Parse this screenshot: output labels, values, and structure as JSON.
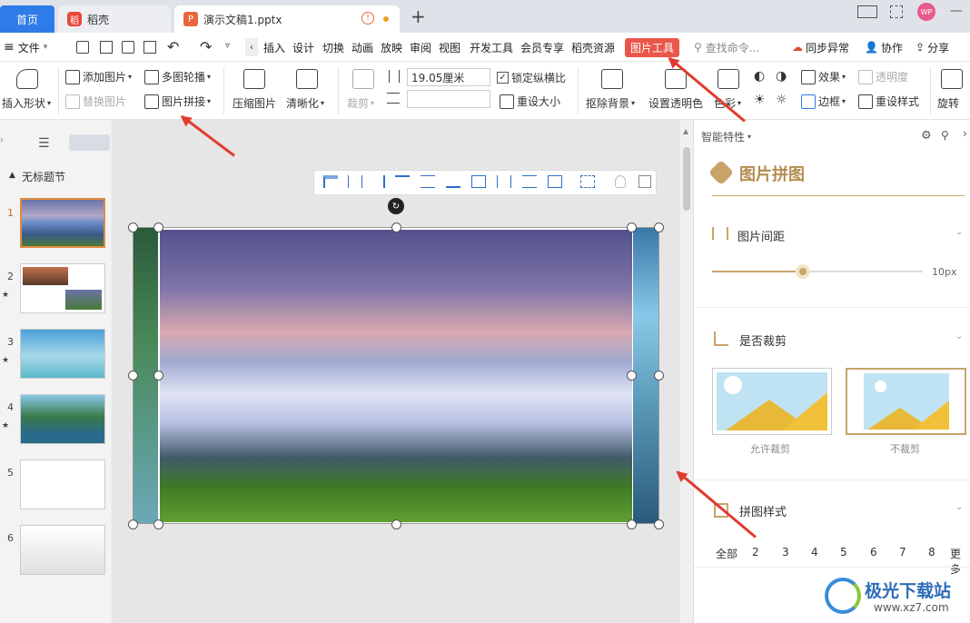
{
  "tabs": {
    "home": "首页",
    "daoke": "稻壳",
    "doc": "演示文稿1.pptx",
    "new": "+"
  },
  "window": {
    "user_initials": "WP",
    "min": "—"
  },
  "menu": {
    "file": "文件",
    "items": [
      "插入",
      "设计",
      "切换",
      "动画",
      "放映",
      "审阅",
      "视图",
      "开发工具",
      "会员专享",
      "稻壳资源"
    ],
    "active": "图片工具",
    "search": "查找命令...",
    "sync": "同步异常",
    "collab": "协作",
    "share": "分享"
  },
  "ribbon": {
    "insert_shape": "插入形状",
    "add_picture": "添加图片",
    "replace_picture": "替换图片",
    "multi_carousel": "多图轮播",
    "picture_stitch": "图片拼接",
    "compress": "压缩图片",
    "sharpen": "清晰化",
    "crop": "裁剪",
    "width_value": "19.05厘米",
    "lock_ratio": "锁定纵横比",
    "reset_size": "重设大小",
    "remove_bg": "抠除背景",
    "set_transparent": "设置透明色",
    "color": "色彩",
    "effect": "效果",
    "transparency": "透明度",
    "border": "边框",
    "reset_style": "重设样式",
    "rotate": "旋转"
  },
  "left_panel": {
    "section": "无标题节",
    "slides": [
      "1",
      "2",
      "3",
      "4",
      "5",
      "6"
    ],
    "star": "★"
  },
  "right_pane": {
    "header": "智能特性",
    "title": "图片拼图",
    "spacing_label": "图片间距",
    "spacing_value": "10px",
    "spacing_fraction": 0.43,
    "crop_label": "是否裁剪",
    "crop_options": [
      "允许裁剪",
      "不裁剪"
    ],
    "style_label": "拼图样式",
    "style_tabs": [
      "全部",
      "2",
      "3",
      "4",
      "5",
      "6",
      "7",
      "8",
      "更多"
    ]
  },
  "watermark": {
    "name": "极光下载站",
    "url": "www.xz7.com"
  },
  "colors": {
    "accent_blue": "#2f7be8",
    "pictool_red": "#e9574a",
    "gold": "#c8a46a",
    "arrow_red": "#e23b2f"
  }
}
